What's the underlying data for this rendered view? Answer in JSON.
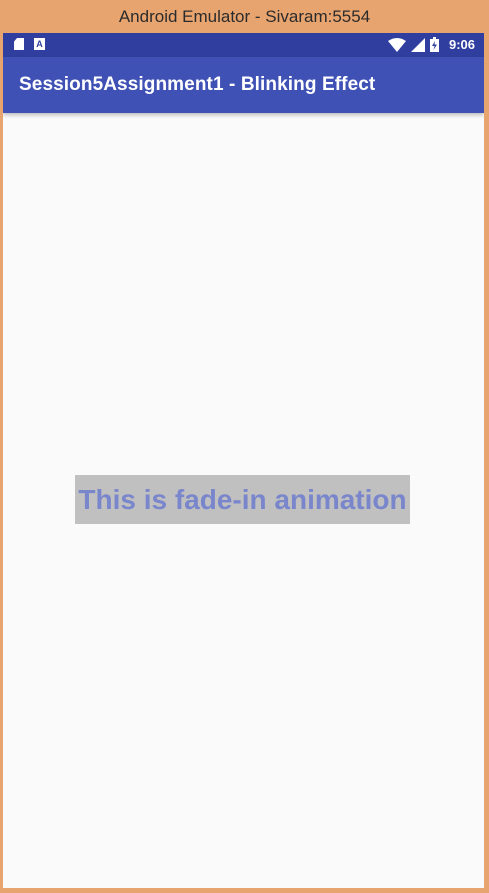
{
  "window": {
    "title": "Android Emulator - Sivaram:5554",
    "frame_color": "#e8a46f"
  },
  "statusbar": {
    "color": "#303f9f",
    "left_icons": [
      "sd-card-icon",
      "a-notification-icon"
    ],
    "right_icons": [
      "wifi-icon",
      "signal-icon",
      "battery-icon"
    ],
    "a_icon_label": "A",
    "time": "9:06"
  },
  "appbar": {
    "title": "Session5Assignment1 - Blinking Effect",
    "color": "#3f51b5"
  },
  "content": {
    "animated_text": "This is fade-in animation",
    "text_color": "#7986cb",
    "text_background": "#c0c0c0"
  }
}
